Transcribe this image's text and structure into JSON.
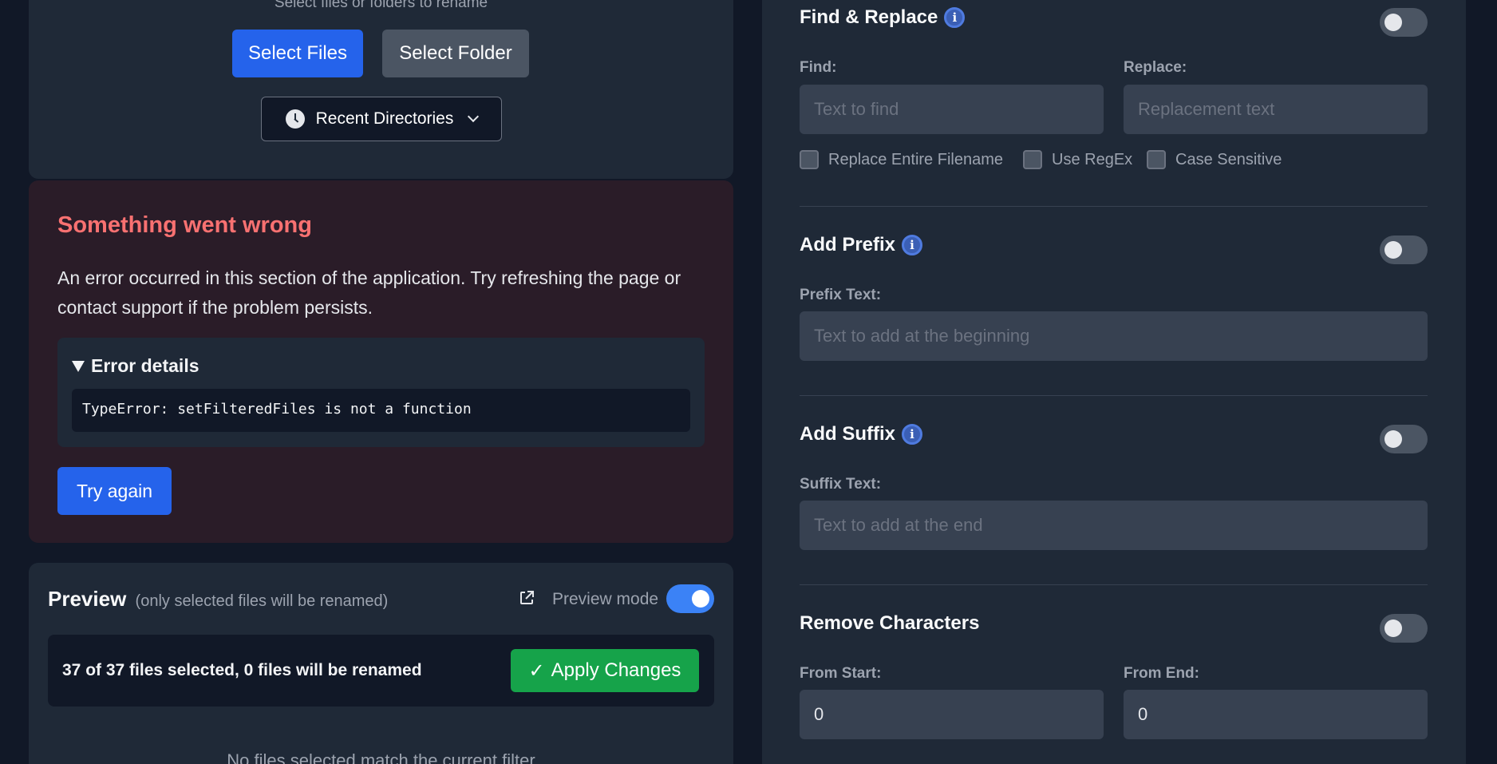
{
  "selector": {
    "hint": "Select files or folders to rename",
    "select_files": "Select Files",
    "select_folder": "Select Folder",
    "recent_directories": "Recent Directories"
  },
  "error": {
    "title": "Something went wrong",
    "description": "An error occurred in this section of the application. Try refreshing the page or contact support if the problem persists.",
    "details_summary": "Error details",
    "details_message": "TypeError: setFilteredFiles is not a function",
    "try_again": "Try again"
  },
  "preview": {
    "title": "Preview",
    "subtitle": "(only selected files will be renamed)",
    "mode_label": "Preview mode",
    "mode_on": true,
    "status": "37 of 37 files selected, 0 files will be renamed",
    "apply_label": "Apply Changes",
    "empty_message": "No files selected match the current filter"
  },
  "rules": {
    "find_replace": {
      "title": "Find & Replace",
      "find_label": "Find:",
      "find_placeholder": "Text to find",
      "replace_label": "Replace:",
      "replace_placeholder": "Replacement text",
      "options": [
        "Replace Entire Filename",
        "Use RegEx",
        "Case Sensitive"
      ],
      "enabled": false
    },
    "prefix": {
      "title": "Add Prefix",
      "label": "Prefix Text:",
      "placeholder": "Text to add at the beginning",
      "enabled": false
    },
    "suffix": {
      "title": "Add Suffix",
      "label": "Suffix Text:",
      "placeholder": "Text to add at the end",
      "enabled": false
    },
    "remove": {
      "title": "Remove Characters",
      "from_start_label": "From Start:",
      "from_start_value": "0",
      "from_end_label": "From End:",
      "from_end_value": "0",
      "enabled": false
    }
  },
  "colors": {
    "background": "#111827",
    "panel": "#1f2937",
    "primary": "#2563eb",
    "success": "#16a34a",
    "error": "#f87171"
  }
}
